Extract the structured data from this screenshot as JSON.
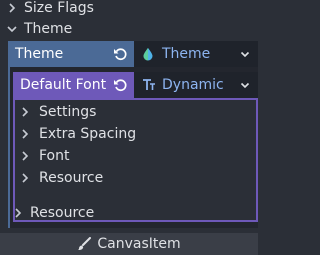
{
  "sections": {
    "size_flags": "Size Flags",
    "theme": "Theme"
  },
  "theme_property": {
    "label": "Theme",
    "value": "Theme",
    "value_icon": "droplet-icon"
  },
  "default_font_property": {
    "label": "Default Font",
    "value": "Dynamic",
    "value_icon": "font-icon"
  },
  "sub_items": [
    "Settings",
    "Extra Spacing",
    "Font",
    "Resource"
  ],
  "outer_resource": "Resource",
  "footer": {
    "label": "CanvasItem",
    "icon": "brush-icon"
  },
  "colors": {
    "theme_accent": "#4b6a96",
    "font_accent": "#6e59b9",
    "value_text": "#8db4f0"
  }
}
